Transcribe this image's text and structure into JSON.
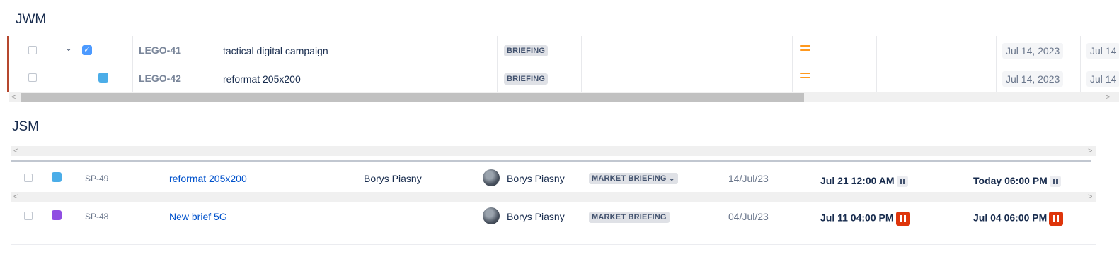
{
  "jwm": {
    "title": "JWM",
    "rows": [
      {
        "key": "LEGO-41",
        "summary": "tactical digital campaign",
        "status": "BRIEFING",
        "date1": "Jul 14, 2023",
        "date2": "Jul 14"
      },
      {
        "key": "LEGO-42",
        "summary": "reformat 205x200",
        "status": "BRIEFING",
        "date1": "Jul 14, 2023",
        "date2": "Jul 14"
      }
    ]
  },
  "jsm": {
    "title": "JSM",
    "rows": [
      {
        "key": "SP-49",
        "summary": "reformat 205x200",
        "reporter": "Borys Piasny",
        "assignee": "Borys Piasny",
        "status": "MARKET BRIEFING",
        "created": "14/Jul/23",
        "sla1": "Jul 21 12:00 AM",
        "sla2": "Today 06:00 PM"
      },
      {
        "key": "SP-48",
        "summary": "New brief 5G",
        "reporter": "",
        "assignee": "Borys Piasny",
        "status": "MARKET BRIEFING",
        "created": "04/Jul/23",
        "sla1": "Jul 11 04:00 PM",
        "sla2": "Jul 04 06:00 PM"
      }
    ]
  },
  "icons": {
    "checkbox": "checkbox-icon",
    "chevron": "chevron-down-icon",
    "subtask": "subtask-icon",
    "story": "story-icon",
    "priority": "priority-medium-icon",
    "pause": "pause-icon"
  },
  "colors": {
    "accent_bar": "#b5472e",
    "link": "#0052cc",
    "priority": "#ff991f",
    "pause_breached": "#de350b"
  }
}
